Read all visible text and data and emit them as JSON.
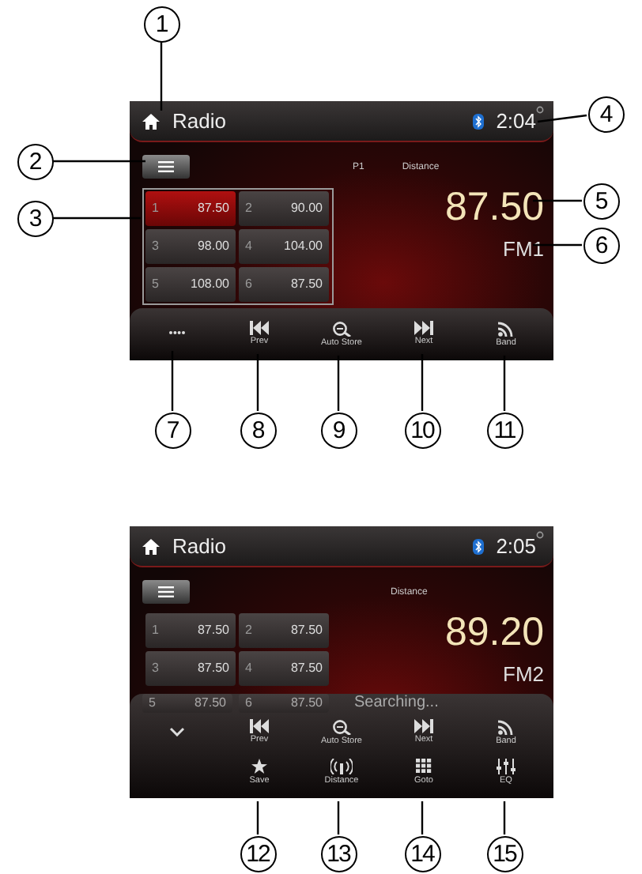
{
  "screens": [
    {
      "title": "Radio",
      "time": "2:04",
      "preset_label": "P1",
      "mode": "Distance",
      "frequency": "87.50",
      "band": "FM1",
      "presets": [
        {
          "number": "1",
          "frequency": "87.50",
          "selected": true
        },
        {
          "number": "2",
          "frequency": "90.00",
          "selected": false
        },
        {
          "number": "3",
          "frequency": "98.00",
          "selected": false
        },
        {
          "number": "4",
          "frequency": "104.00",
          "selected": false
        },
        {
          "number": "5",
          "frequency": "108.00",
          "selected": false
        },
        {
          "number": "6",
          "frequency": "87.50",
          "selected": false
        }
      ],
      "toolbar_rows": [
        [
          {
            "kind": "dots"
          },
          {
            "kind": "prev",
            "label": "Prev"
          },
          {
            "kind": "search",
            "label": "Auto Store"
          },
          {
            "kind": "next",
            "label": "Next"
          },
          {
            "kind": "band",
            "label": "Band"
          }
        ]
      ]
    },
    {
      "title": "Radio",
      "time": "2:05",
      "mode": "Distance",
      "frequency": "89.20",
      "band": "FM2",
      "status": "Searching...",
      "presets": [
        {
          "number": "1",
          "frequency": "87.50",
          "selected": false
        },
        {
          "number": "2",
          "frequency": "87.50",
          "selected": false
        },
        {
          "number": "3",
          "frequency": "87.50",
          "selected": false
        },
        {
          "number": "4",
          "frequency": "87.50",
          "selected": false
        },
        {
          "number": "5",
          "frequency": "87.50",
          "selected": false
        },
        {
          "number": "6",
          "frequency": "87.50",
          "selected": false
        }
      ],
      "toolbar_rows": [
        [
          {
            "kind": "chevron"
          },
          {
            "kind": "prev",
            "label": "Prev"
          },
          {
            "kind": "search",
            "label": "Auto Store"
          },
          {
            "kind": "next",
            "label": "Next"
          },
          {
            "kind": "band",
            "label": "Band"
          }
        ],
        [
          {
            "kind": "blank"
          },
          {
            "kind": "save",
            "label": "Save"
          },
          {
            "kind": "distance",
            "label": "Distance"
          },
          {
            "kind": "goto",
            "label": "Goto"
          },
          {
            "kind": "eq",
            "label": "EQ"
          }
        ]
      ]
    }
  ],
  "callouts": [
    {
      "label": "1"
    },
    {
      "label": "2"
    },
    {
      "label": "3"
    },
    {
      "label": "4"
    },
    {
      "label": "5"
    },
    {
      "label": "6"
    },
    {
      "label": "7"
    },
    {
      "label": "8"
    },
    {
      "label": "9"
    },
    {
      "label": "10"
    },
    {
      "label": "11"
    },
    {
      "label": "12"
    },
    {
      "label": "13"
    },
    {
      "label": "14"
    },
    {
      "label": "15"
    }
  ]
}
